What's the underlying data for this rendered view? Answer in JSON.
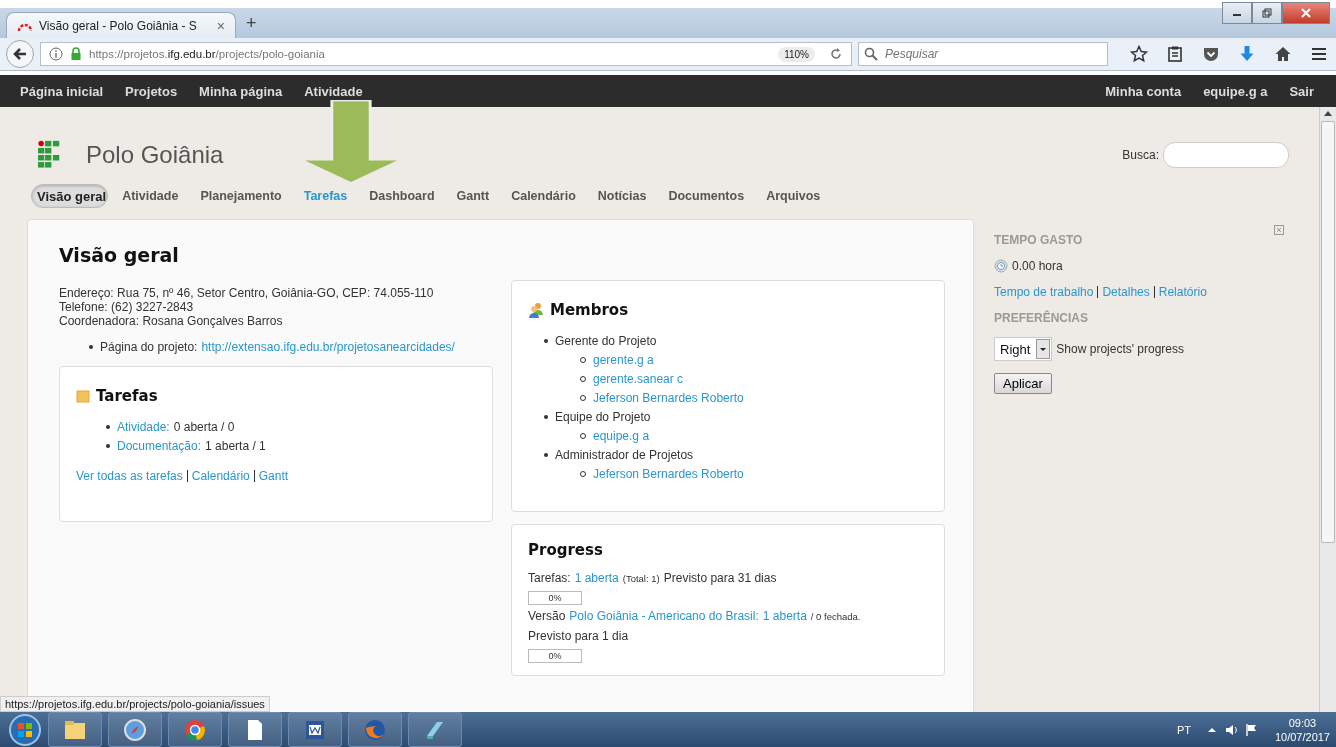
{
  "browser": {
    "tab_title": "Visão geral - Polo Goiânia - S",
    "tab_close": "×",
    "new_tab": "+",
    "url_prefix": "https://projetos.",
    "url_domain": "ifg.edu.br",
    "url_path": "/projects/polo-goiania",
    "zoom": "110%",
    "search": {
      "placeholder": "Pesquisar"
    }
  },
  "top_menu": {
    "left": [
      "Página inicial",
      "Projetos",
      "Minha página",
      "Atividade"
    ],
    "right": [
      "Minha conta",
      "equipe.g a",
      "Sair"
    ]
  },
  "project": {
    "title": "Polo Goiânia",
    "search_label": "Busca:"
  },
  "tabs": [
    {
      "label": "Visão geral",
      "selected": true,
      "hovered": false
    },
    {
      "label": "Atividade",
      "selected": false,
      "hovered": false
    },
    {
      "label": "Planejamento",
      "selected": false,
      "hovered": false
    },
    {
      "label": "Tarefas",
      "selected": false,
      "hovered": true
    },
    {
      "label": "Dashboard",
      "selected": false,
      "hovered": false
    },
    {
      "label": "Gantt",
      "selected": false,
      "hovered": false
    },
    {
      "label": "Calendário",
      "selected": false,
      "hovered": false
    },
    {
      "label": "Notícias",
      "selected": false,
      "hovered": false
    },
    {
      "label": "Documentos",
      "selected": false,
      "hovered": false
    },
    {
      "label": "Arquivos",
      "selected": false,
      "hovered": false
    }
  ],
  "overview": {
    "title": "Visão geral",
    "info": [
      "Endereço: Rua 75, nº 46, Setor Centro, Goiânia-GO, CEP: 74.055-110",
      "Telefone: (62) 3227-2843",
      "Coordenadora: Rosana Gonçalves Barros"
    ],
    "homepage_label": "Página do projeto:",
    "homepage_link": "http://extensao.ifg.edu.br/projetosanearcidades/"
  },
  "tasks_box": {
    "title": "Tarefas",
    "items": [
      {
        "link": "Atividade:",
        "text": "0 aberta / 0"
      },
      {
        "link": "Documentação:",
        "text": "1 aberta / 1"
      }
    ],
    "footer_links": [
      "Ver todas as tarefas",
      "Calendário",
      "Gantt"
    ]
  },
  "members_box": {
    "title": "Membros",
    "groups": [
      {
        "role": "Gerente do Projeto",
        "members": [
          "gerente.g a",
          "gerente.sanear c",
          "Jeferson Bernardes Roberto"
        ]
      },
      {
        "role": "Equipe do Projeto",
        "members": [
          "equipe.g a"
        ]
      },
      {
        "role": "Administrador de Projetos",
        "members": [
          "Jeferson Bernardes Roberto"
        ]
      }
    ]
  },
  "progress_box": {
    "title": "Progress",
    "issues_label": "Tarefas:",
    "issues_link": "1 aberta",
    "issues_total": "(Total: 1)",
    "issues_due": "Previsto para 31 dias",
    "issues_bar": {
      "level": 0,
      "reading": "0%"
    },
    "version_label": "Versão",
    "version_link": "Polo Goiânia - Americano do Brasil:",
    "version_open": "1 aberta",
    "version_closed": "/ 0 fechada.",
    "version_due": "Previsto para 1 dia",
    "version_bar": {
      "level": 0,
      "reading": "0%"
    }
  },
  "sidebar": {
    "time_heading": "TEMPO GASTO",
    "time_value": "0.00 hora",
    "time_links": [
      "Tempo de trabalho",
      "Detalhes",
      "Relatório"
    ],
    "prefs_heading": "PREFERÊNCIAS",
    "select_value": "Right",
    "select_label": "Show projects' progress",
    "apply_button": "Aplicar"
  },
  "status_url": "https://projetos.ifg.edu.br/projects/polo-goiania/issues",
  "taskbar": {
    "language": "PT",
    "time": "09:03",
    "date": "10/07/2017"
  }
}
